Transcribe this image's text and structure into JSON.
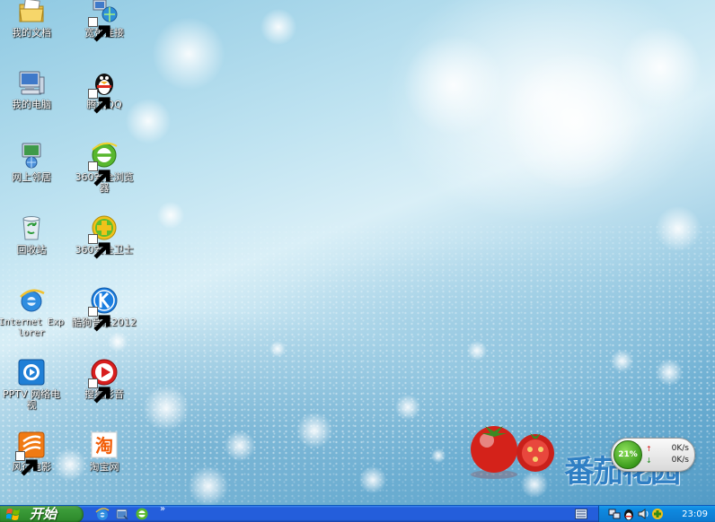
{
  "desktop": {
    "icons": [
      {
        "label": "我的文档",
        "icon": "my-documents-icon"
      },
      {
        "label": "我的电脑",
        "icon": "my-computer-icon"
      },
      {
        "label": "网上邻居",
        "icon": "network-places-icon"
      },
      {
        "label": "回收站",
        "icon": "recycle-bin-icon"
      },
      {
        "label": "Internet Explorer",
        "icon": "internet-explorer-icon"
      },
      {
        "label": "PPTV 网络电视",
        "icon": "pptv-icon"
      },
      {
        "label": "风行电影",
        "icon": "funshion-icon"
      },
      {
        "label": "宽带连接",
        "icon": "broadband-connection-icon"
      },
      {
        "label": "腾讯QQ",
        "icon": "qq-penguin-icon"
      },
      {
        "label": "360安全浏览器",
        "icon": "360-browser-icon"
      },
      {
        "label": "360安全卫士",
        "icon": "360-safeguard-icon"
      },
      {
        "label": "酷狗音乐2012",
        "icon": "kugou-music-icon"
      },
      {
        "label": "搜狐影音",
        "icon": "sohu-video-icon"
      },
      {
        "label": "淘宝网",
        "icon": "taobao-icon"
      }
    ],
    "brand_text": "番茄花园",
    "netmon": {
      "cpu_percent": "21%",
      "upload": "0K/s",
      "download": "0K/s",
      "up_arrow": "↑",
      "down_arrow": "↓"
    }
  },
  "taskbar": {
    "start_label": "开始",
    "more_indicator": "»",
    "clock": "23:09",
    "quick_launch": [
      "internet-explorer-icon",
      "show-desktop-icon",
      "360-browser-icon"
    ],
    "tray": [
      "network-icon",
      "qq-icon",
      "sound-icon",
      "360-tray-icon"
    ]
  },
  "colors": {
    "taskbar": "#245edb",
    "start_button": "#3c9c3a",
    "tray": "#0f8ae0",
    "brand": "#2f7fc4"
  }
}
